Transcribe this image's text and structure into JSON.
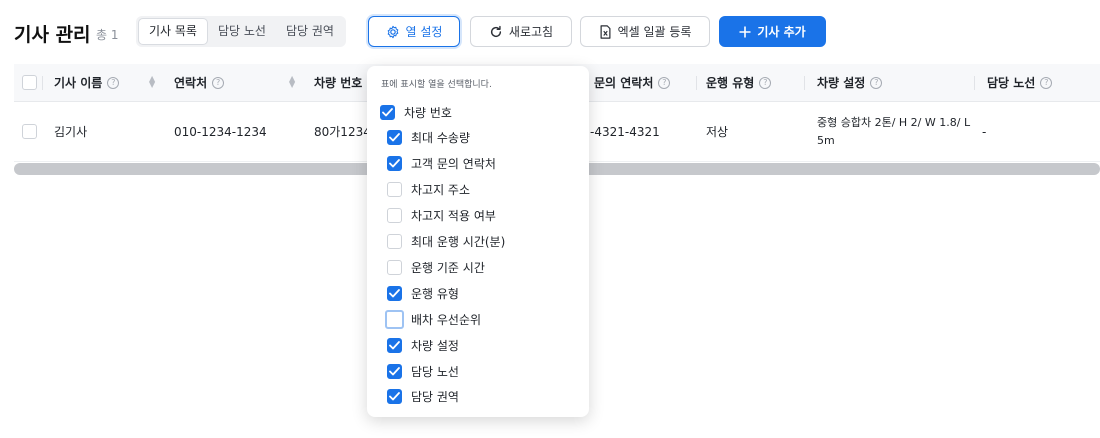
{
  "header": {
    "title": "기사 관리",
    "count": "총 1",
    "tabs": [
      {
        "label": "기사 목록",
        "active": true
      },
      {
        "label": "담당 노선",
        "active": false
      },
      {
        "label": "담당 권역",
        "active": false
      }
    ],
    "column_settings_label": "열 설정",
    "refresh_label": "새로고침",
    "excel_label": "엑셀 일괄 등록",
    "add_label": "기사 추가"
  },
  "colors": {
    "accent": "#1a73e8"
  },
  "table": {
    "columns": {
      "name": "기사 이름",
      "contact": "연락처",
      "vehicle_no": "차량 번호",
      "customer_contact": "문의 연락처",
      "operation_type": "운행 유형",
      "vehicle_setting": "차량 설정",
      "route": "담당 노선"
    },
    "rows": [
      {
        "name": "김기사",
        "contact": "010-1234-1234",
        "vehicle_no": "80가1234",
        "customer_contact": "-4321-4321",
        "operation_type": "저상",
        "vehicle_setting": "중형 승합차 2톤/ H 2/ W 1.8/ L 5m",
        "route": "-"
      }
    ]
  },
  "column_menu": {
    "hint": "표에 표시할 열을 선택합니다.",
    "items": [
      {
        "label": "차량 번호",
        "checked": true
      },
      {
        "label": "최대 수송량",
        "checked": true
      },
      {
        "label": "고객 문의 연락처",
        "checked": true
      },
      {
        "label": "차고지 주소",
        "checked": false
      },
      {
        "label": "차고지 적용 여부",
        "checked": false
      },
      {
        "label": "최대 운행 시간(분)",
        "checked": false
      },
      {
        "label": "운행 기준 시간",
        "checked": false
      },
      {
        "label": "운행 유형",
        "checked": true
      },
      {
        "label": "배차 우선순위",
        "checked": false,
        "focused": true
      },
      {
        "label": "차량 설정",
        "checked": true
      },
      {
        "label": "담당 노선",
        "checked": true
      },
      {
        "label": "담당 권역",
        "checked": true
      }
    ]
  }
}
